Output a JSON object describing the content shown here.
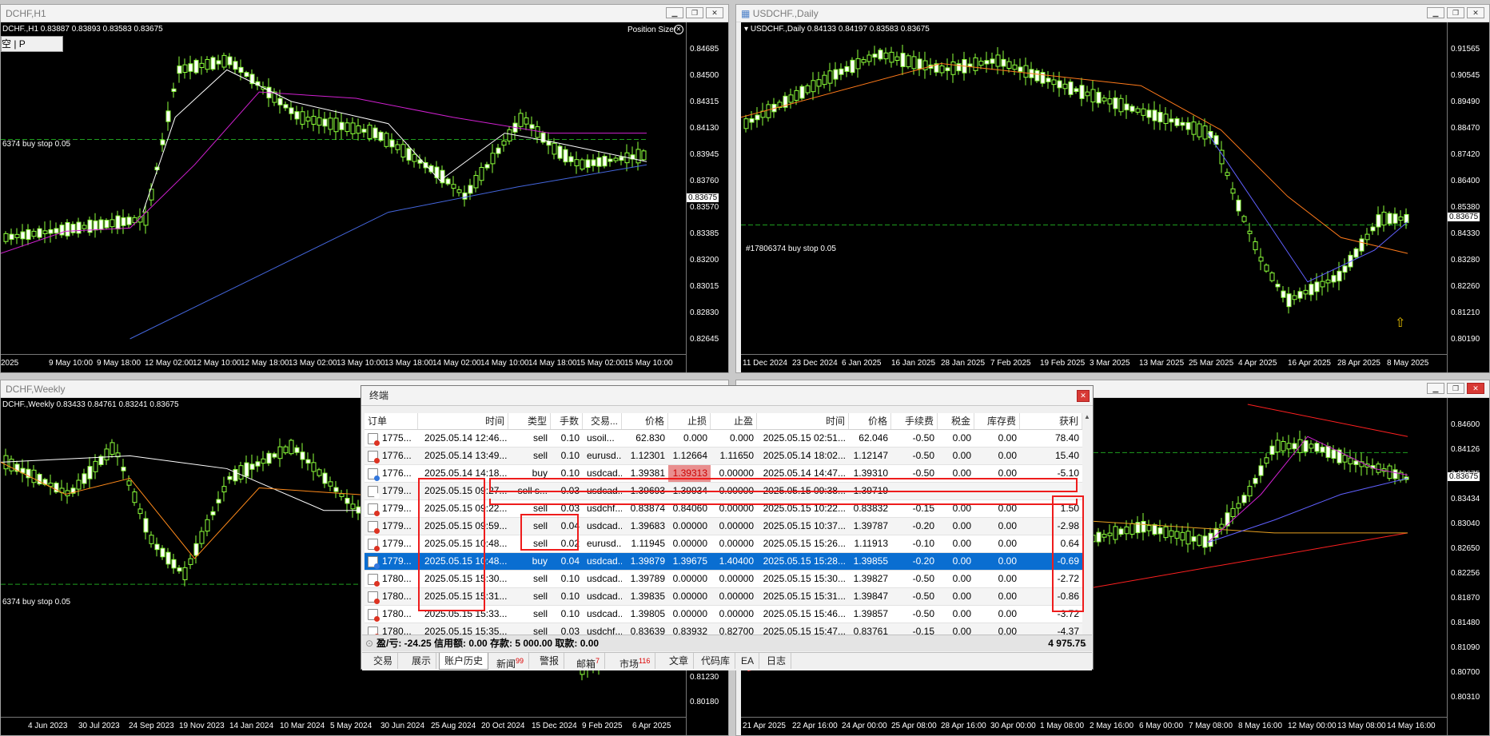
{
  "windows": {
    "h1": {
      "title": "DCHF,H1",
      "info": "DCHF.,H1  0.83887 0.83893 0.83583 0.83675",
      "position_sizer": "Position Sizer",
      "pending": "6374 buy stop 0.05",
      "mini_panel": "空 | P",
      "current_price": "0.83675",
      "price_ticks": [
        "0.84685",
        "0.84500",
        "0.84315",
        "0.84130",
        "0.83945",
        "0.83760",
        "0.83570",
        "0.83385",
        "0.83200",
        "0.83015",
        "0.82830",
        "0.82645"
      ],
      "time_ticks": [
        "2025",
        "9 May 10:00",
        "9 May 18:00",
        "12 May 02:00",
        "12 May 10:00",
        "12 May 18:00",
        "13 May 02:00",
        "13 May 10:00",
        "13 May 18:00",
        "14 May 02:00",
        "14 May 10:00",
        "14 May 18:00",
        "15 May 02:00",
        "15 May 10:00"
      ]
    },
    "daily": {
      "title": "USDCHF.,Daily",
      "info": "USDCHF.,Daily  0.84133 0.84197 0.83583 0.83675",
      "pending": "#17806374 buy stop 0.05",
      "current_price": "0.83675",
      "price_ticks": [
        "0.91565",
        "0.90545",
        "0.89490",
        "0.88470",
        "0.87420",
        "0.86400",
        "0.85380",
        "0.84330",
        "0.83280",
        "0.82260",
        "0.81210",
        "0.80190"
      ],
      "time_ticks": [
        "11 Dec 2024",
        "23 Dec 2024",
        "6 Jan 2025",
        "16 Jan 2025",
        "28 Jan 2025",
        "7 Feb 2025",
        "19 Feb 2025",
        "3 Mar 2025",
        "13 Mar 2025",
        "25 Mar 2025",
        "4 Apr 2025",
        "16 Apr 2025",
        "28 Apr 2025",
        "8 May 2025"
      ]
    },
    "weekly": {
      "title": "DCHF,Weekly",
      "info": "DCHF.,Weekly  0.83433 0.84761 0.83241 0.83675",
      "pending": "6374 buy stop 0.05",
      "price_ticks": [
        "0.81230",
        "0.80180"
      ],
      "time_ticks": [
        "4 Jun 2023",
        "30 Jul 2023",
        "24 Sep 2023",
        "19 Nov 2023",
        "14 Jan 2024",
        "10 Mar 2024",
        "5 May 2024",
        "30 Jun 2024",
        "25 Aug 2024",
        "20 Oct 2024",
        "15 Dec 2024",
        "9 Feb 2025",
        "6 Apr 2025"
      ]
    },
    "m": {
      "current_price": "0.83675",
      "price_ticks": [
        "0.84600",
        "0.84126",
        "0.83675",
        "0.83434",
        "0.83040",
        "0.82650",
        "0.82256",
        "0.81870",
        "0.81480",
        "0.81090",
        "0.80700",
        "0.80310"
      ],
      "time_ticks": [
        "21 Apr 2025",
        "22 Apr 16:00",
        "24 Apr 00:00",
        "25 Apr 08:00",
        "28 Apr 16:00",
        "30 Apr 00:00",
        "1 May 08:00",
        "2 May 16:00",
        "6 May 00:00",
        "7 May 08:00",
        "8 May 16:00",
        "12 May 00:00",
        "13 May 08:00",
        "14 May 16:00"
      ]
    }
  },
  "terminal": {
    "title": "终端",
    "columns": [
      "订单",
      "时间",
      "类型",
      "手数",
      "交易...",
      "价格",
      "止损",
      "止盈",
      "时间",
      "价格",
      "手续费",
      "税金",
      "库存费",
      "获利"
    ],
    "rows": [
      {
        "icon": "sell",
        "order": "1775...",
        "t1": "2025.05.14 12:46...",
        "type": "sell",
        "lots": "0.10",
        "sym": "usoil...",
        "price": "62.830",
        "sl": "0.000",
        "tp": "0.000",
        "t2": "2025.05.15 02:51...",
        "p2": "62.046",
        "comm": "-0.50",
        "tax": "0.00",
        "swap": "0.00",
        "profit": "78.40"
      },
      {
        "icon": "sell",
        "order": "1776...",
        "t1": "2025.05.14 13:49...",
        "type": "sell",
        "lots": "0.10",
        "sym": "eurusd...",
        "price": "1.12301",
        "sl": "1.12664",
        "tp": "1.11650",
        "t2": "2025.05.14 18:02...",
        "p2": "1.12147",
        "comm": "-0.50",
        "tax": "0.00",
        "swap": "0.00",
        "profit": "15.40"
      },
      {
        "icon": "buy",
        "order": "1776...",
        "t1": "2025.05.14 14:18...",
        "type": "buy",
        "lots": "0.10",
        "sym": "usdcad...",
        "price": "1.39381",
        "sl": "1.39313",
        "tp": "0.00000",
        "t2": "2025.05.14 14:47...",
        "p2": "1.39310",
        "comm": "-0.50",
        "tax": "0.00",
        "swap": "0.00",
        "profit": "-5.10"
      },
      {
        "icon": "pend",
        "order": "1779...",
        "t1": "2025.05.15 09:27...",
        "type": "sell s...",
        "lots": "0.03",
        "sym": "usdcad...",
        "price": "1.39693",
        "sl": "1.39934",
        "tp": "0.00000",
        "t2": "2025.05.15 09:38...",
        "p2": "1.39719",
        "comm": "",
        "tax": "",
        "swap": "",
        "profit": ""
      },
      {
        "icon": "sell",
        "order": "1779...",
        "t1": "2025.05.15 09:22...",
        "type": "sell",
        "lots": "0.03",
        "sym": "usdchf...",
        "price": "0.83874",
        "sl": "0.84060",
        "tp": "0.00000",
        "t2": "2025.05.15 10:22...",
        "p2": "0.83832",
        "comm": "-0.15",
        "tax": "0.00",
        "swap": "0.00",
        "profit": "1.50"
      },
      {
        "icon": "sell",
        "order": "1779...",
        "t1": "2025.05.15 09:59...",
        "type": "sell",
        "lots": "0.04",
        "sym": "usdcad...",
        "price": "1.39683",
        "sl": "0.00000",
        "tp": "0.00000",
        "t2": "2025.05.15 10:37...",
        "p2": "1.39787",
        "comm": "-0.20",
        "tax": "0.00",
        "swap": "0.00",
        "profit": "-2.98"
      },
      {
        "icon": "sell",
        "order": "1779...",
        "t1": "2025.05.15 10:48...",
        "type": "sell",
        "lots": "0.02",
        "sym": "eurusd...",
        "price": "1.11945",
        "sl": "0.00000",
        "tp": "0.00000",
        "t2": "2025.05.15 15:26...",
        "p2": "1.11913",
        "comm": "-0.10",
        "tax": "0.00",
        "swap": "0.00",
        "profit": "0.64"
      },
      {
        "icon": "buy",
        "order": "1779...",
        "t1": "2025.05.15 10:48...",
        "type": "buy",
        "lots": "0.04",
        "sym": "usdcad...",
        "price": "1.39879",
        "sl": "1.39675",
        "tp": "1.40400",
        "t2": "2025.05.15 15:28...",
        "p2": "1.39855",
        "comm": "-0.20",
        "tax": "0.00",
        "swap": "0.00",
        "profit": "-0.69"
      },
      {
        "icon": "sell",
        "order": "1780...",
        "t1": "2025.05.15 15:30...",
        "type": "sell",
        "lots": "0.10",
        "sym": "usdcad...",
        "price": "1.39789",
        "sl": "0.00000",
        "tp": "0.00000",
        "t2": "2025.05.15 15:30...",
        "p2": "1.39827",
        "comm": "-0.50",
        "tax": "0.00",
        "swap": "0.00",
        "profit": "-2.72"
      },
      {
        "icon": "sell",
        "order": "1780...",
        "t1": "2025.05.15 15:31...",
        "type": "sell",
        "lots": "0.10",
        "sym": "usdcad...",
        "price": "1.39835",
        "sl": "0.00000",
        "tp": "0.00000",
        "t2": "2025.05.15 15:31...",
        "p2": "1.39847",
        "comm": "-0.50",
        "tax": "0.00",
        "swap": "0.00",
        "profit": "-0.86"
      },
      {
        "icon": "sell",
        "order": "1780...",
        "t1": "2025.05.15 15:33...",
        "type": "sell",
        "lots": "0.10",
        "sym": "usdcad...",
        "price": "1.39805",
        "sl": "0.00000",
        "tp": "0.00000",
        "t2": "2025.05.15 15:46...",
        "p2": "1.39857",
        "comm": "-0.50",
        "tax": "0.00",
        "swap": "0.00",
        "profit": "-3.72"
      },
      {
        "icon": "sell",
        "order": "1780...",
        "t1": "2025.05.15 15:35...",
        "type": "sell",
        "lots": "0.03",
        "sym": "usdchf...",
        "price": "0.83639",
        "sl": "0.83932",
        "tp": "0.82700",
        "t2": "2025.05.15 15:47...",
        "p2": "0.83761",
        "comm": "-0.15",
        "tax": "0.00",
        "swap": "0.00",
        "profit": "-4.37"
      }
    ],
    "summary": "盈/亏: -24.25  信用额: 0.00  存款: 5 000.00  取款: 0.00",
    "summary_total": "4 975.75",
    "tabs": [
      {
        "label": "交易",
        "badge": ""
      },
      {
        "label": "展示",
        "badge": ""
      },
      {
        "label": "账户历史",
        "badge": ""
      },
      {
        "label": "新闻",
        "badge": "99"
      },
      {
        "label": "警报",
        "badge": ""
      },
      {
        "label": "邮箱",
        "badge": "7"
      },
      {
        "label": "市场",
        "badge": "116"
      },
      {
        "label": "文章",
        "badge": ""
      },
      {
        "label": "代码库",
        "badge": ""
      },
      {
        "label": "EA",
        "badge": ""
      },
      {
        "label": "日志",
        "badge": ""
      }
    ]
  }
}
